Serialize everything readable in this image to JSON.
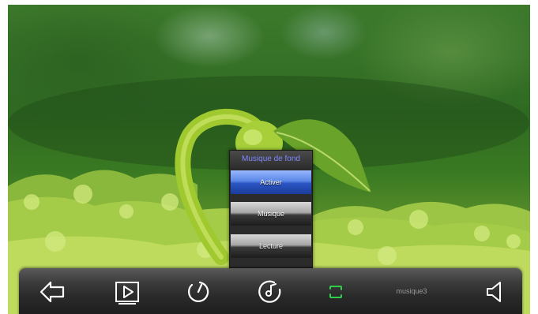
{
  "menu": {
    "title": "Musique de fond",
    "items": [
      {
        "label": "Activer",
        "selected": true
      },
      {
        "label": "Musique",
        "selected": false
      },
      {
        "label": "Lecture",
        "selected": false
      }
    ]
  },
  "toolbar": {
    "track_name": "musique3",
    "icons": [
      "back-arrow-icon",
      "play-icon",
      "timer-icon",
      "music-disc-icon",
      "repeat-icon",
      "volume-icon"
    ],
    "accent_color": "#2fcf4a"
  }
}
